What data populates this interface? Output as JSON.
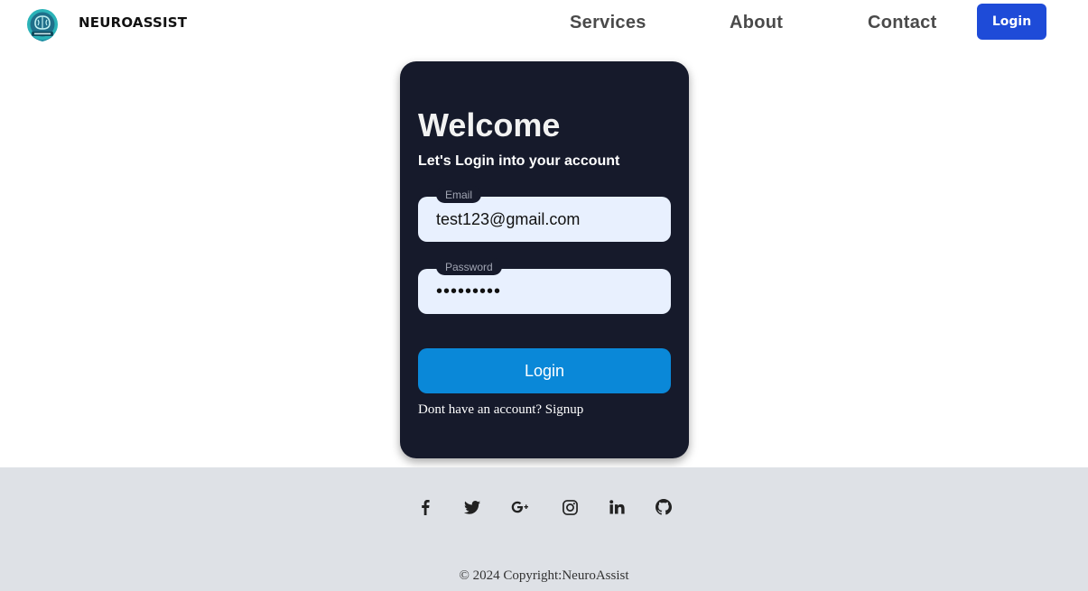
{
  "header": {
    "brand": "NEUROASSIST",
    "logo_icon": "brain-badge-icon",
    "nav": [
      {
        "label": "Services"
      },
      {
        "label": "About"
      },
      {
        "label": "Contact"
      }
    ],
    "login_label": "Login",
    "login_color": "#1e4bd8"
  },
  "card": {
    "title": "Welcome",
    "subtitle": "Let's Login into your account",
    "email": {
      "label": "Email",
      "value": "test123@gmail.com"
    },
    "password": {
      "label": "Password",
      "value": "testtest1"
    },
    "login_button": "Login",
    "login_button_color": "#0a88d8",
    "signup_prompt": "Dont have an account? ",
    "signup_link": "Signup",
    "background": "#161a2b"
  },
  "footer": {
    "social_icons": [
      "facebook-icon",
      "twitter-icon",
      "google-plus-icon",
      "instagram-icon",
      "linkedin-icon",
      "github-icon"
    ],
    "copyright": "© 2024 Copyright:NeuroAssist",
    "background": "#dee1e6"
  }
}
